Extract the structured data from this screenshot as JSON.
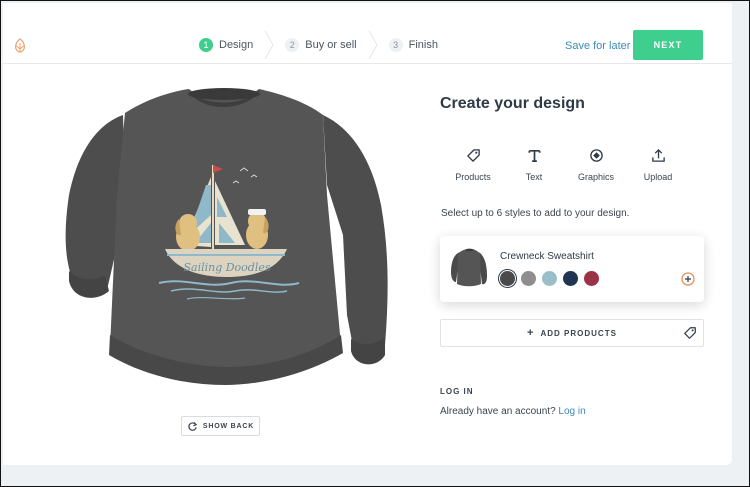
{
  "header": {
    "steps": [
      {
        "num": "1",
        "label": "Design",
        "state": "active"
      },
      {
        "num": "2",
        "label": "Buy or sell",
        "state": "inactive"
      },
      {
        "num": "3",
        "label": "Finish",
        "state": "inactive"
      }
    ],
    "save_later": "Save for later",
    "next_label": "NEXT"
  },
  "canvas": {
    "design_text": "Sailing Doodles",
    "show_back_label": "SHOW BACK"
  },
  "panel": {
    "title": "Create your design",
    "tools": [
      {
        "label": "Products",
        "icon": "tag-icon"
      },
      {
        "label": "Text",
        "icon": "text-icon"
      },
      {
        "label": "Graphics",
        "icon": "graphics-icon"
      },
      {
        "label": "Upload",
        "icon": "upload-icon"
      }
    ],
    "hint": "Select up to 6 styles to add to your design.",
    "product": {
      "name": "Crewneck Sweatshirt",
      "colors": [
        "#4a4a4a",
        "#8e8e8e",
        "#9bbfc9",
        "#1f3552",
        "#9b3346"
      ]
    },
    "add_products_label": "ADD PRODUCTS",
    "login_heading": "LOG IN",
    "login_prompt": "Already have an account?",
    "login_link": "Log in"
  },
  "colors": {
    "accent": "#3ecf8e",
    "link": "#3b8bb8"
  }
}
